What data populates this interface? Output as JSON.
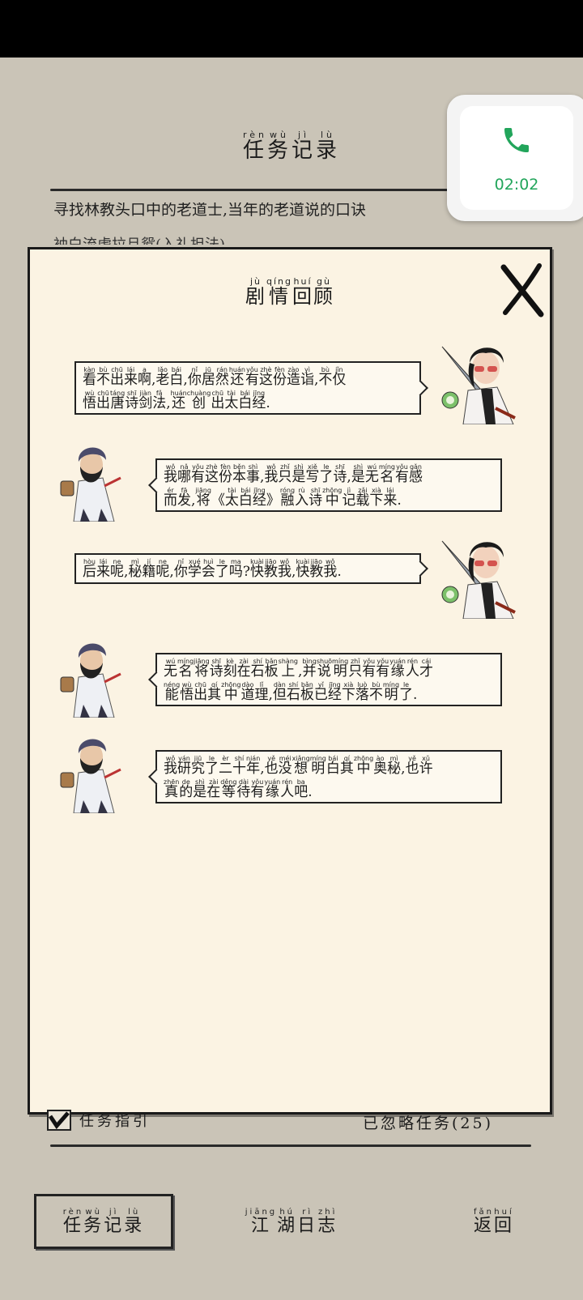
{
  "status_bar": {},
  "call": {
    "time": "02:02",
    "icon": "phone-icon",
    "color": "#22a55b"
  },
  "background": {
    "title": [
      {
        "py": "rèn",
        "hz": "任"
      },
      {
        "py": "wù",
        "hz": "务"
      },
      {
        "py": "jì",
        "hz": "记"
      },
      {
        "py": "lù",
        "hz": "录"
      }
    ],
    "task_line1": "寻找林教头口中的老道士,当年的老道说的口诀",
    "task_line2": "袖白流虎拉旦鸳(入礼担法)"
  },
  "modal": {
    "title": [
      {
        "py": "jù",
        "hz": "剧"
      },
      {
        "py": "qíng",
        "hz": "情"
      },
      {
        "py": "huí",
        "hz": "回"
      },
      {
        "py": "gù",
        "hz": "顾"
      }
    ],
    "close_icon": "close-x-icon",
    "dialogues": [
      {
        "speaker": "player",
        "lines": [
          [
            {
              "py": "kàn",
              "hz": "看"
            },
            {
              "py": "bù",
              "hz": "不"
            },
            {
              "py": "chū",
              "hz": "出"
            },
            {
              "py": "lái",
              "hz": "来"
            },
            {
              "py": "a",
              "hz": "啊"
            },
            {
              "py": "",
              "hz": ","
            },
            {
              "py": "lǎo",
              "hz": "老"
            },
            {
              "py": "bái",
              "hz": "白"
            },
            {
              "py": "",
              "hz": ","
            },
            {
              "py": "nǐ",
              "hz": "你"
            },
            {
              "py": "jū",
              "hz": "居"
            },
            {
              "py": "rán",
              "hz": "然"
            },
            {
              "py": "huán",
              "hz": "还"
            },
            {
              "py": "yǒu",
              "hz": "有"
            },
            {
              "py": "zhè",
              "hz": "这"
            },
            {
              "py": "fèn",
              "hz": "份"
            },
            {
              "py": "zào",
              "hz": "造"
            },
            {
              "py": "yì",
              "hz": "诣"
            },
            {
              "py": "",
              "hz": ","
            },
            {
              "py": "bù",
              "hz": "不"
            },
            {
              "py": "jǐn",
              "hz": "仅"
            }
          ],
          [
            {
              "py": "wù",
              "hz": "悟"
            },
            {
              "py": "chū",
              "hz": "出"
            },
            {
              "py": "táng",
              "hz": "唐"
            },
            {
              "py": "shī",
              "hz": "诗"
            },
            {
              "py": "jiàn",
              "hz": "剑"
            },
            {
              "py": "fǎ",
              "hz": "法"
            },
            {
              "py": "",
              "hz": ","
            },
            {
              "py": "huán",
              "hz": "还"
            },
            {
              "py": "chuàng",
              "hz": "创"
            },
            {
              "py": "chū",
              "hz": "出"
            },
            {
              "py": "tài",
              "hz": "太"
            },
            {
              "py": "bái",
              "hz": "白"
            },
            {
              "py": "jīng",
              "hz": "经"
            },
            {
              "py": "",
              "hz": "."
            }
          ]
        ]
      },
      {
        "speaker": "elder",
        "lines": [
          [
            {
              "py": "wǒ",
              "hz": "我"
            },
            {
              "py": "nǎ",
              "hz": "哪"
            },
            {
              "py": "yǒu",
              "hz": "有"
            },
            {
              "py": "zhè",
              "hz": "这"
            },
            {
              "py": "fèn",
              "hz": "份"
            },
            {
              "py": "běn",
              "hz": "本"
            },
            {
              "py": "shì",
              "hz": "事"
            },
            {
              "py": "",
              "hz": ","
            },
            {
              "py": "wǒ",
              "hz": "我"
            },
            {
              "py": "zhǐ",
              "hz": "只"
            },
            {
              "py": "shì",
              "hz": "是"
            },
            {
              "py": "xiě",
              "hz": "写"
            },
            {
              "py": "le",
              "hz": "了"
            },
            {
              "py": "shī",
              "hz": "诗"
            },
            {
              "py": "",
              "hz": ","
            },
            {
              "py": "shì",
              "hz": "是"
            },
            {
              "py": "wú",
              "hz": "无"
            },
            {
              "py": "míng",
              "hz": "名"
            },
            {
              "py": "yǒu",
              "hz": "有"
            },
            {
              "py": "gǎn",
              "hz": "感"
            }
          ],
          [
            {
              "py": "ér",
              "hz": "而"
            },
            {
              "py": "fā",
              "hz": "发"
            },
            {
              "py": "",
              "hz": ","
            },
            {
              "py": "jiāng",
              "hz": "将"
            },
            {
              "py": "",
              "hz": "《"
            },
            {
              "py": "tài",
              "hz": "太"
            },
            {
              "py": "bái",
              "hz": "白"
            },
            {
              "py": "jīng",
              "hz": "经"
            },
            {
              "py": "",
              "hz": "》"
            },
            {
              "py": "róng",
              "hz": "融"
            },
            {
              "py": "rù",
              "hz": "入"
            },
            {
              "py": "shī",
              "hz": "诗"
            },
            {
              "py": "zhōng",
              "hz": "中"
            },
            {
              "py": "jì",
              "hz": "记"
            },
            {
              "py": "zǎi",
              "hz": "载"
            },
            {
              "py": "xià",
              "hz": "下"
            },
            {
              "py": "lái",
              "hz": "来"
            },
            {
              "py": "",
              "hz": "."
            }
          ]
        ]
      },
      {
        "speaker": "player",
        "lines": [
          [
            {
              "py": "hòu",
              "hz": "后"
            },
            {
              "py": "lái",
              "hz": "来"
            },
            {
              "py": "ne",
              "hz": "呢"
            },
            {
              "py": "",
              "hz": ","
            },
            {
              "py": "mì",
              "hz": "秘"
            },
            {
              "py": "jí",
              "hz": "籍"
            },
            {
              "py": "ne",
              "hz": "呢"
            },
            {
              "py": "",
              "hz": ","
            },
            {
              "py": "nǐ",
              "hz": "你"
            },
            {
              "py": "xué",
              "hz": "学"
            },
            {
              "py": "huì",
              "hz": "会"
            },
            {
              "py": "le",
              "hz": "了"
            },
            {
              "py": "ma",
              "hz": "吗"
            },
            {
              "py": "",
              "hz": "?"
            },
            {
              "py": "kuài",
              "hz": "快"
            },
            {
              "py": "jiāo",
              "hz": "教"
            },
            {
              "py": "wǒ",
              "hz": "我"
            },
            {
              "py": "",
              "hz": ","
            },
            {
              "py": "kuài",
              "hz": "快"
            },
            {
              "py": "jiāo",
              "hz": "教"
            },
            {
              "py": "wǒ",
              "hz": "我"
            },
            {
              "py": "",
              "hz": "."
            }
          ]
        ]
      },
      {
        "speaker": "elder",
        "lines": [
          [
            {
              "py": "wú",
              "hz": "无"
            },
            {
              "py": "míng",
              "hz": "名"
            },
            {
              "py": "jiāng",
              "hz": "将"
            },
            {
              "py": "shī",
              "hz": "诗"
            },
            {
              "py": "kè",
              "hz": "刻"
            },
            {
              "py": "zài",
              "hz": "在"
            },
            {
              "py": "shí",
              "hz": "石"
            },
            {
              "py": "bǎn",
              "hz": "板"
            },
            {
              "py": "shàng",
              "hz": "上"
            },
            {
              "py": "",
              "hz": ","
            },
            {
              "py": "bìng",
              "hz": "并"
            },
            {
              "py": "shuō",
              "hz": "说"
            },
            {
              "py": "míng",
              "hz": "明"
            },
            {
              "py": "zhǐ",
              "hz": "只"
            },
            {
              "py": "yǒu",
              "hz": "有"
            },
            {
              "py": "yǒu",
              "hz": "有"
            },
            {
              "py": "yuán",
              "hz": "缘"
            },
            {
              "py": "rén",
              "hz": "人"
            },
            {
              "py": "cái",
              "hz": "才"
            }
          ],
          [
            {
              "py": "néng",
              "hz": "能"
            },
            {
              "py": "wù",
              "hz": "悟"
            },
            {
              "py": "chū",
              "hz": "出"
            },
            {
              "py": "qí",
              "hz": "其"
            },
            {
              "py": "zhōng",
              "hz": "中"
            },
            {
              "py": "dào",
              "hz": "道"
            },
            {
              "py": "lǐ",
              "hz": "理"
            },
            {
              "py": "",
              "hz": ","
            },
            {
              "py": "dàn",
              "hz": "但"
            },
            {
              "py": "shí",
              "hz": "石"
            },
            {
              "py": "bǎn",
              "hz": "板"
            },
            {
              "py": "yǐ",
              "hz": "已"
            },
            {
              "py": "jīng",
              "hz": "经"
            },
            {
              "py": "xià",
              "hz": "下"
            },
            {
              "py": "luò",
              "hz": "落"
            },
            {
              "py": "bù",
              "hz": "不"
            },
            {
              "py": "míng",
              "hz": "明"
            },
            {
              "py": "le",
              "hz": "了"
            },
            {
              "py": "",
              "hz": "."
            }
          ]
        ]
      },
      {
        "speaker": "elder",
        "lines": [
          [
            {
              "py": "wǒ",
              "hz": "我"
            },
            {
              "py": "yán",
              "hz": "研"
            },
            {
              "py": "jiū",
              "hz": "究"
            },
            {
              "py": "le",
              "hz": "了"
            },
            {
              "py": "èr",
              "hz": "二"
            },
            {
              "py": "shí",
              "hz": "十"
            },
            {
              "py": "nián",
              "hz": "年"
            },
            {
              "py": "",
              "hz": ","
            },
            {
              "py": "yě",
              "hz": "也"
            },
            {
              "py": "méi",
              "hz": "没"
            },
            {
              "py": "xiǎng",
              "hz": "想"
            },
            {
              "py": "míng",
              "hz": "明"
            },
            {
              "py": "bái",
              "hz": "白"
            },
            {
              "py": "qí",
              "hz": "其"
            },
            {
              "py": "zhōng",
              "hz": "中"
            },
            {
              "py": "ào",
              "hz": "奥"
            },
            {
              "py": "mì",
              "hz": "秘"
            },
            {
              "py": "",
              "hz": ","
            },
            {
              "py": "yě",
              "hz": "也"
            },
            {
              "py": "xǔ",
              "hz": "许"
            }
          ],
          [
            {
              "py": "zhēn",
              "hz": "真"
            },
            {
              "py": "de",
              "hz": "的"
            },
            {
              "py": "shì",
              "hz": "是"
            },
            {
              "py": "zài",
              "hz": "在"
            },
            {
              "py": "děng",
              "hz": "等"
            },
            {
              "py": "dài",
              "hz": "待"
            },
            {
              "py": "yǒu",
              "hz": "有"
            },
            {
              "py": "yuán",
              "hz": "缘"
            },
            {
              "py": "rén",
              "hz": "人"
            },
            {
              "py": "ba",
              "hz": "吧"
            },
            {
              "py": "",
              "hz": "."
            }
          ]
        ]
      }
    ]
  },
  "footer": {
    "guide_label": "任务指引",
    "ignored_label": "已忽略任务(25)",
    "nav": [
      {
        "id": "records",
        "active": true,
        "text": [
          {
            "py": "rèn",
            "hz": "任"
          },
          {
            "py": "wù",
            "hz": "务"
          },
          {
            "py": "jì",
            "hz": "记"
          },
          {
            "py": "lù",
            "hz": "录"
          }
        ]
      },
      {
        "id": "journal",
        "active": false,
        "text": [
          {
            "py": "jiāng",
            "hz": "江"
          },
          {
            "py": "hú",
            "hz": "湖"
          },
          {
            "py": "rì",
            "hz": "日"
          },
          {
            "py": "zhì",
            "hz": "志"
          }
        ]
      },
      {
        "id": "back",
        "active": false,
        "text": [
          {
            "py": "fǎn",
            "hz": "返"
          },
          {
            "py": "huí",
            "hz": "回"
          }
        ]
      }
    ]
  }
}
